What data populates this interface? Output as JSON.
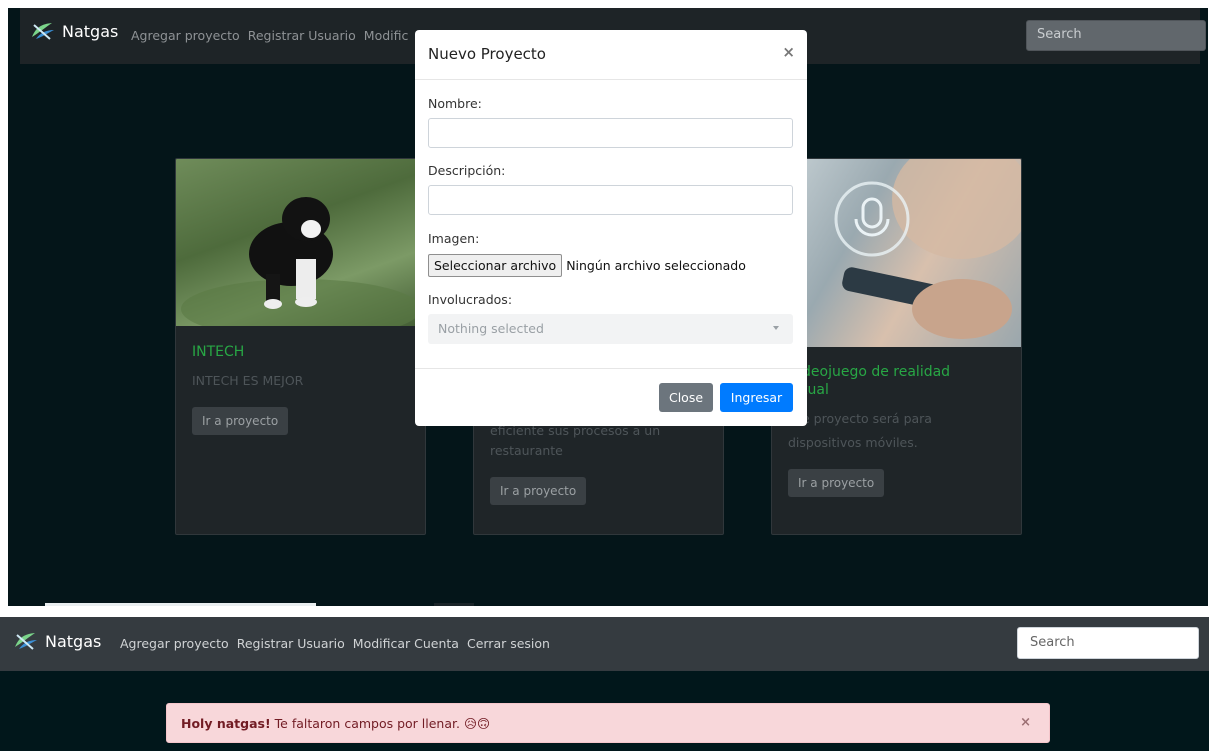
{
  "brand": "Natgas",
  "nav": [
    "Agregar proyecto",
    "Registrar Usuario",
    "Modificar Cuenta",
    "Cerrar sesion"
  ],
  "nav_top_visible": [
    "Agregar proyecto",
    "Registrar Usuario",
    "Modific"
  ],
  "search_placeholder": "Search",
  "cards": [
    {
      "title": "INTECH",
      "text": "INTECH ES MEJOR",
      "button": "Ir a proyecto"
    },
    {
      "text_line1": "eficiente sus procesos a un",
      "text_line2": "restaurante",
      "button": "Ir a proyecto"
    },
    {
      "title_line1": "deojuego de realidad",
      "title_line2": "tual",
      "text_line1": "e proyecto será para",
      "text_line2": "dispositivos móviles.",
      "button": "Ir a proyecto"
    }
  ],
  "modal": {
    "title": "Nuevo Proyecto",
    "close_glyph": "×",
    "fields": {
      "nombre": "Nombre:",
      "descripcion": "Descripción:",
      "imagen": "Imagen:",
      "involucrados": "Involucrados:"
    },
    "file_button": "Seleccionar archivo",
    "file_status": "Ningún archivo seleccionado",
    "select_placeholder": "Nothing selected",
    "close_button": "Close",
    "submit_button": "Ingresar"
  },
  "alert": {
    "strong": "Holy natgas!",
    "message": " Te faltaron campos por llenar. 😥🙃",
    "close_glyph": "×"
  },
  "colors": {
    "page_dark": "#041519",
    "navbar_top": "#1e2427",
    "navbar_bottom": "#353b40",
    "card_title_green": "#28a745",
    "primary_blue": "#007bff",
    "secondary_gray": "#6c757d",
    "alert_bg": "#f8d7da",
    "alert_text": "#721c24"
  }
}
